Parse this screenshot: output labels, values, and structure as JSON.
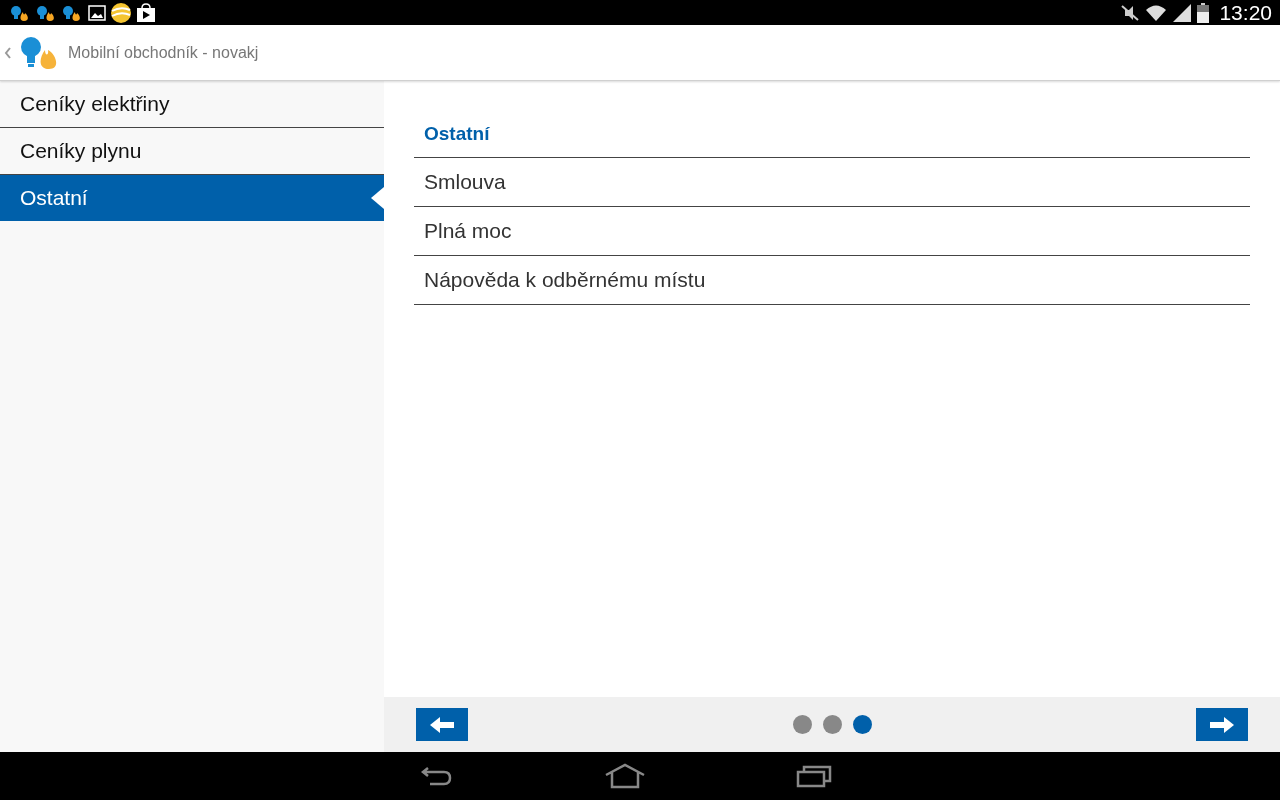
{
  "status_bar": {
    "time": "13:20"
  },
  "app_bar": {
    "title": "Mobilní obchodník - novakj"
  },
  "sidebar": {
    "items": [
      {
        "label": "Ceníky elektřiny",
        "selected": false
      },
      {
        "label": "Ceníky plynu",
        "selected": false
      },
      {
        "label": "Ostatní",
        "selected": true
      }
    ]
  },
  "content": {
    "heading": "Ostatní",
    "items": [
      "Smlouva",
      "Plná moc",
      "Nápověda k odběrnému místu"
    ]
  },
  "pager": {
    "pages": [
      {
        "selected": false
      },
      {
        "selected": false
      },
      {
        "selected": true
      }
    ]
  }
}
